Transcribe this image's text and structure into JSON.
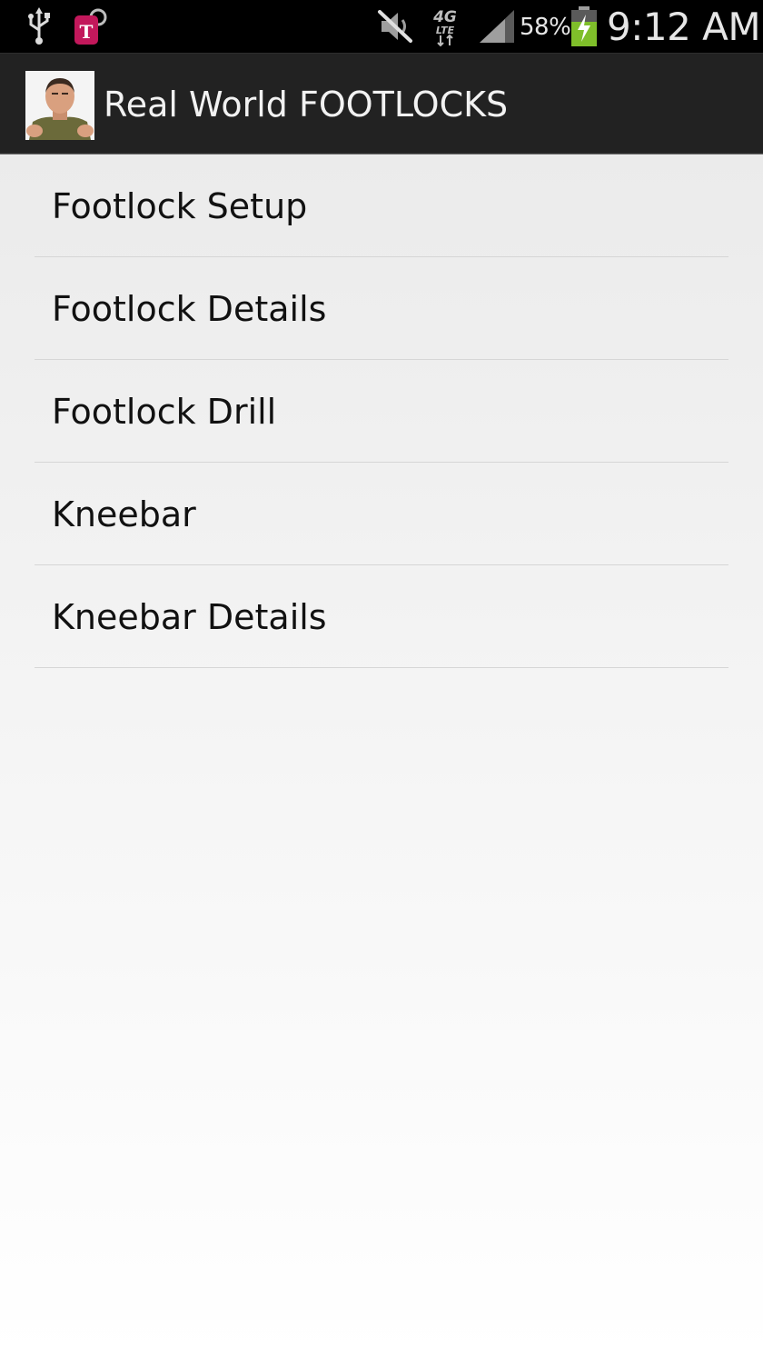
{
  "status_bar": {
    "battery_percent": "58%",
    "time": "9:12 AM",
    "network_label": "4G LTE",
    "carrier_letter": "T",
    "icons": [
      "usb-icon",
      "tmobile-icon",
      "mute-icon",
      "lte-icon",
      "signal-icon",
      "battery-charging-icon"
    ],
    "colors": {
      "background": "#000000",
      "text": "#e6e6e6",
      "battery_fill": "#7fbf2a",
      "carrier": "#c2185b"
    }
  },
  "action_bar": {
    "title": "Real World FOOTLOCKS",
    "icon": "app-icon",
    "background": "#222222"
  },
  "menu": {
    "items": [
      {
        "label": "Footlock Setup"
      },
      {
        "label": "Footlock Details"
      },
      {
        "label": "Footlock Drill"
      },
      {
        "label": "Kneebar"
      },
      {
        "label": "Kneebar Details"
      }
    ]
  }
}
